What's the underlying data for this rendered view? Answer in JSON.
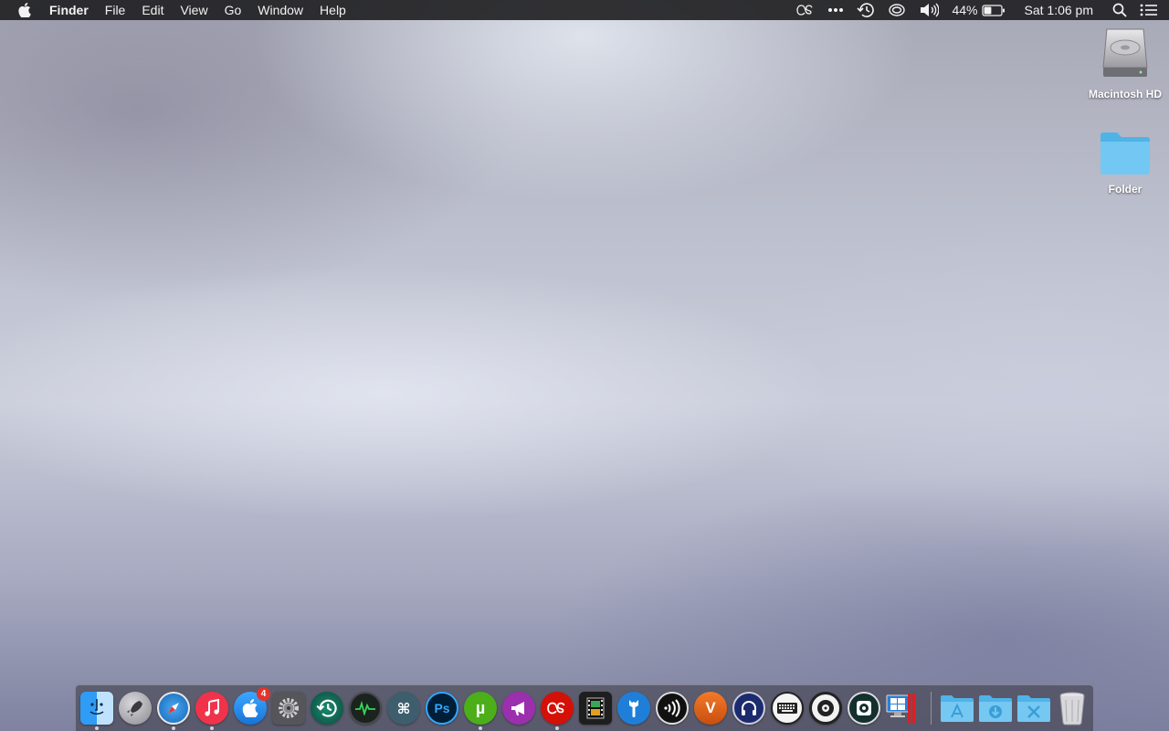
{
  "menubar": {
    "app_name": "Finder",
    "menus": [
      "File",
      "Edit",
      "View",
      "Go",
      "Window",
      "Help"
    ],
    "status": {
      "battery_percent": "44%",
      "battery_level": 0.44,
      "clock": "Sat 1:06 pm"
    }
  },
  "desktop_icons": [
    {
      "label": "Macintosh HD",
      "icon": "hard-drive-icon"
    },
    {
      "label": "Folder",
      "icon": "folder-icon"
    }
  ],
  "dock": {
    "apps": [
      {
        "name": "finder",
        "icon": "finder-icon",
        "color": "#1e8cf0",
        "running": true
      },
      {
        "name": "launchpad",
        "icon": "rocket-icon",
        "color": "#9a9aa0",
        "running": false
      },
      {
        "name": "safari",
        "icon": "compass-icon",
        "color": "#1a7fd4",
        "running": true
      },
      {
        "name": "music",
        "icon": "music-note-icon",
        "color": "#f0334b",
        "running": true
      },
      {
        "name": "app-store",
        "icon": "app-store-icon",
        "color": "#1d8ff0",
        "running": false,
        "badge": "4"
      },
      {
        "name": "system-preferences",
        "icon": "gear-icon",
        "color": "#5a5a5e",
        "running": false
      },
      {
        "name": "time-machine",
        "icon": "clock-arrow-icon",
        "color": "#0f6b5a",
        "running": false
      },
      {
        "name": "activity-monitor",
        "icon": "activity-wave-icon",
        "color": "#1f2a22",
        "running": false
      },
      {
        "name": "keyboard-shortcuts",
        "icon": "command-key-icon",
        "color": "#3e5e6e",
        "running": false
      },
      {
        "name": "photoshop",
        "icon": "photoshop-icon",
        "color": "#001e36",
        "running": false
      },
      {
        "name": "utorrent",
        "icon": "utorrent-icon",
        "color": "#4caf1a",
        "running": true
      },
      {
        "name": "megaphone-app",
        "icon": "megaphone-icon",
        "color": "#9b2fae",
        "running": false
      },
      {
        "name": "lastfm",
        "icon": "lastfm-icon",
        "color": "#d51007",
        "running": true
      },
      {
        "name": "video-editor",
        "icon": "film-strip-icon",
        "color": "#1e1e1e",
        "running": false
      },
      {
        "name": "utility-app",
        "icon": "wrench-icon",
        "color": "#1f7fd8",
        "running": false
      },
      {
        "name": "nfc-app",
        "icon": "signal-waves-icon",
        "color": "#111111",
        "running": false
      },
      {
        "name": "vivaldi",
        "icon": "vivaldi-icon",
        "color": "#e0651a",
        "running": false
      },
      {
        "name": "headphones-app",
        "icon": "headphones-icon",
        "color": "#1c2b6e",
        "running": false
      },
      {
        "name": "keyboard-app",
        "icon": "keyboard-icon",
        "color": "#f2f2f2",
        "running": false
      },
      {
        "name": "disc-app",
        "icon": "disc-icon",
        "color": "#f0f0f0",
        "running": false
      },
      {
        "name": "camera-app",
        "icon": "camera-icon",
        "color": "#13302e",
        "running": false
      },
      {
        "name": "parallels",
        "icon": "windows-monitor-icon",
        "color": "#2b7fd6",
        "running": false
      }
    ],
    "stacks": [
      {
        "name": "applications-stack",
        "icon": "applications-folder-icon"
      },
      {
        "name": "downloads-stack",
        "icon": "downloads-folder-icon"
      },
      {
        "name": "utilities-stack",
        "icon": "utilities-folder-icon"
      }
    ],
    "trash": {
      "name": "trash",
      "icon": "trash-icon"
    }
  }
}
